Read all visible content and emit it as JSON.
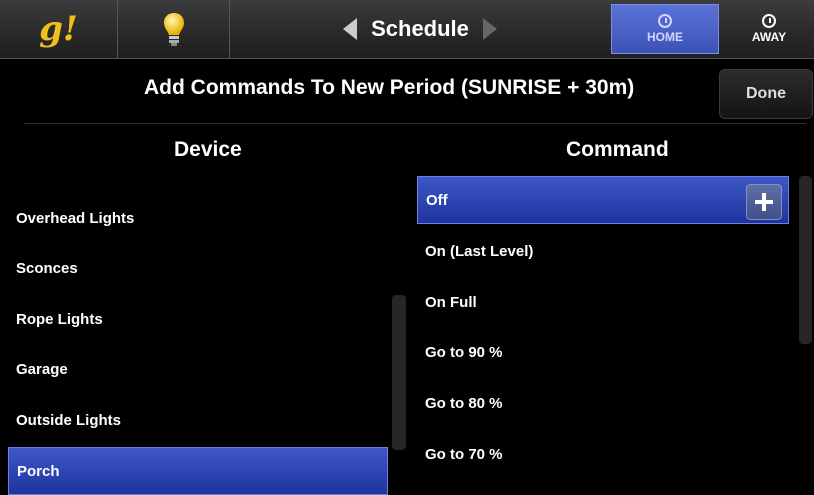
{
  "toolbar": {
    "logo": "g!",
    "title": "Schedule",
    "home_label": "HOME",
    "away_label": "AWAY"
  },
  "header": {
    "title": "Add Commands To New Period (SUNRISE + 30m)",
    "done_label": "Done"
  },
  "columns": {
    "device": "Device",
    "command": "Command"
  },
  "devices": [
    "Overhead Lights",
    "Sconces",
    "Rope Lights",
    "Garage",
    "Outside Lights",
    "Porch"
  ],
  "selected_device": "Porch",
  "commands": [
    "Off",
    "On (Last Level)",
    "On Full",
    "Go to 90 %",
    "Go to 80 %",
    "Go to 70 %"
  ],
  "selected_command": "Off",
  "colors": {
    "accent": "#3f57c6",
    "logo": "#f0c01a"
  },
  "icons": [
    "lightbulb-icon",
    "left-arrow-icon",
    "right-arrow-icon",
    "clock-icon",
    "plus-icon"
  ]
}
